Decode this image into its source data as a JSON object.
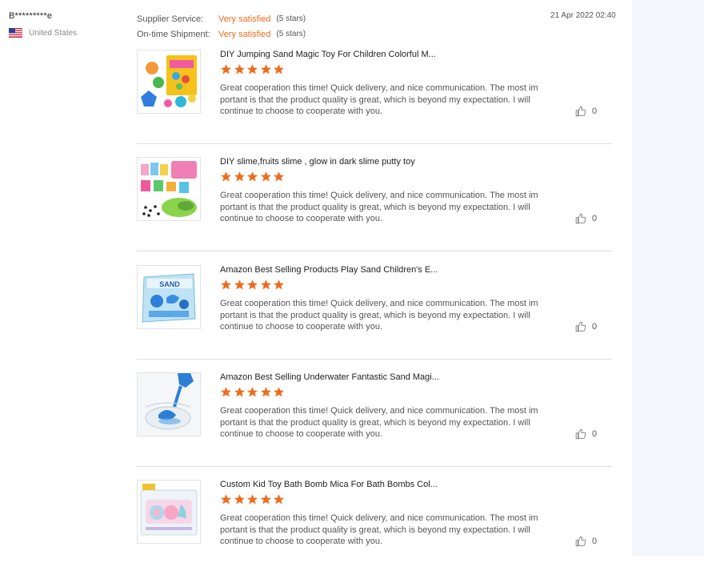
{
  "reviewer": {
    "name": "B*********e",
    "country": "United States",
    "flag_icon": "us-flag-icon"
  },
  "ratings": [
    {
      "label": "Supplier Service:",
      "value": "Very satisfied",
      "stars": "(5 stars)"
    },
    {
      "label": "On-time Shipment:",
      "value": "Very satisfied",
      "stars": "(5 stars)"
    }
  ],
  "review_date": "21 Apr 2022 02:40",
  "colors": {
    "accent": "#f06b1d",
    "star": "#f06b1d",
    "panel": "#f3f7fb"
  },
  "items": [
    {
      "title": "DIY Jumping Sand Magic Toy For Children Colorful M...",
      "rating": 5,
      "text": "Great cooperation this time! Quick delivery, and nice communication. The most im portant is that the product quality is great, which is beyond my expectation. I will continue to choose to cooperate with you.",
      "likes": "0"
    },
    {
      "title": "DIY slime,fruits slime , glow in dark slime putty toy",
      "rating": 5,
      "text": "Great cooperation this time! Quick delivery, and nice communication. The most im portant is that the product quality is great, which is beyond my expectation. I will continue to choose to cooperate with you.",
      "likes": "0"
    },
    {
      "title": "Amazon Best Selling Products Play Sand Children's E...",
      "rating": 5,
      "text": "Great cooperation this time! Quick delivery, and nice communication. The most im portant is that the product quality is great, which is beyond my expectation. I will continue to choose to cooperate with you.",
      "likes": "0"
    },
    {
      "title": "Amazon Best Selling Underwater Fantastic Sand Magi...",
      "rating": 5,
      "text": "Great cooperation this time! Quick delivery, and nice communication. The most im portant is that the product quality is great, which is beyond my expectation. I will continue to choose to cooperate with you.",
      "likes": "0"
    },
    {
      "title": "Custom Kid Toy Bath Bomb Mica For Bath Bombs Col...",
      "rating": 5,
      "text": "Great cooperation this time! Quick delivery, and nice communication. The most im portant is that the product quality is great, which is beyond my expectation. I will continue to choose to cooperate with you.",
      "likes": "0"
    }
  ],
  "thumbnail_images": [
    {
      "icon": "magic-sand-kit-image",
      "box_text": ""
    },
    {
      "icon": "slime-kit-image",
      "box_text": ""
    },
    {
      "icon": "play-sand-box-image",
      "box_text": "SAND"
    },
    {
      "icon": "water-sand-cup-image",
      "box_text": ""
    },
    {
      "icon": "bath-bomb-box-image",
      "box_text": ""
    }
  ]
}
